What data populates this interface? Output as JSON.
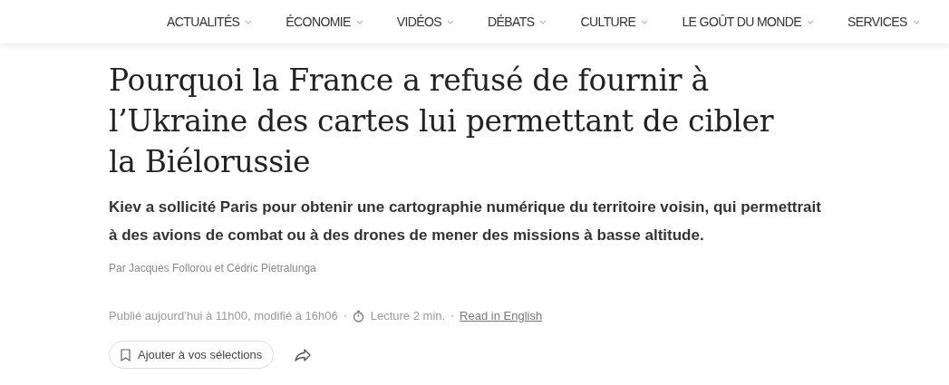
{
  "nav": {
    "items": [
      {
        "label": "ACTUALITÉS"
      },
      {
        "label": "ÉCONOMIE"
      },
      {
        "label": "VIDÉOS"
      },
      {
        "label": "DÉBATS"
      },
      {
        "label": "CULTURE"
      },
      {
        "label": "LE GOÛT DU MONDE"
      },
      {
        "label": "SERVICES"
      }
    ]
  },
  "article": {
    "title": "Pourquoi la France a refusé de fournir à l’Ukraine des cartes lui permettant de cibler la Biélorussie",
    "standfirst": "Kiev a sollicité Paris pour obtenir une cartographie numérique du territoire voisin, qui permettrait à des avions de combat ou à des drones de mener des missions à basse altitude.",
    "byline": "Par Jacques Follorou et Cédric Pietralunga",
    "published": "Publié aujourd’hui à 11h00, modifié à 16h06",
    "reading_time": "Lecture 2 min.",
    "translation_link": "Read in English",
    "save_button": "Ajouter à vos sélections"
  }
}
